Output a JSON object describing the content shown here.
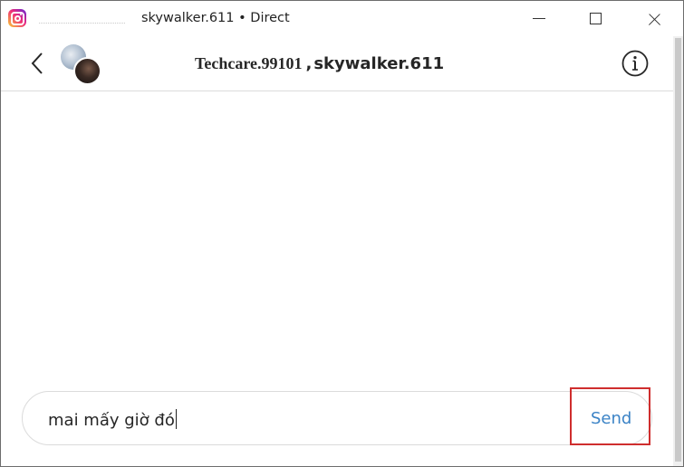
{
  "window": {
    "title": "skywalker.611 • Direct",
    "app_icon": "instagram-icon"
  },
  "header": {
    "participant_1": "Techcare.99101",
    "separator": ",",
    "participant_2": "skywalker.611",
    "back_icon": "chevron-left-icon",
    "info_icon": "info-icon"
  },
  "composer": {
    "value": "mai mấy giờ đó",
    "send_label": "Send"
  },
  "colors": {
    "send": "#3b83c6",
    "highlight": "#cf2e2e",
    "border": "#dbdbdb"
  }
}
